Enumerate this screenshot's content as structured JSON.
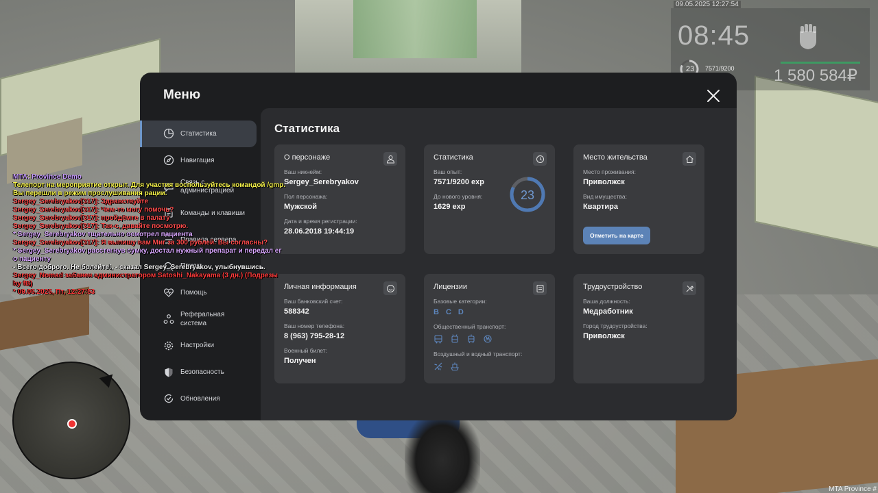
{
  "hud": {
    "date": "09.05.2025 12:27:54",
    "time": "08:45",
    "level": "23",
    "exp": "7571/9200",
    "money": "1 580 584₽"
  },
  "watermark": "MTA Province #",
  "chat": [
    {
      "text": "MTA: Province Demo",
      "color": "#c79bff"
    },
    {
      "text": "Телепорт на мероприятие открыт. Для участия воспользуйтесь командой /gmp.",
      "color": "#f5f24a"
    },
    {
      "text": "Вы перешли в режим прослушивания рации.",
      "color": "#f5f24a"
    },
    {
      "text": "Sergey_Serebryakov[317]: Здравствуйте",
      "color": "#ff4b4b"
    },
    {
      "text": "Sergey_Serebryakov[317]: Чем-то могу помочь?",
      "color": "#ff4b4b"
    },
    {
      "text": "Sergey_Serebryakov[317]: пройдёмте в палату",
      "color": "#ff4b4b"
    },
    {
      "text": "Sergey_Serebryakov[317]: Так-с, давайте посмотрю.",
      "color": "#ff4b4b"
    },
    {
      "text": " * Sergey_Serebryakov тщательно осмотрел пациента",
      "color": "#d9a7ff"
    },
    {
      "text": "Sergey_Serebryakov[317]: Я выпишу вам Миг за 300 рублей. Вы согласны?",
      "color": "#ff4b4b"
    },
    {
      "text": " * Sergey_Serebryakov расстегнув сумку, достал нужный препарат и передал ег",
      "color": "#d9a7ff"
    },
    {
      "text": "о пациенту",
      "color": "#d9a7ff"
    },
    {
      "text": " - Всего доброго. Не болейте!, - сказал Sergey_Serebryakov, улыбнувшись.",
      "color": "#f0f0f0"
    },
    {
      "text": " Sergey_Nomad забанен администратором Satoshi_Nakayama (3 дн.) (Подрезы",
      "color": "#ff3b3b"
    },
    {
      "text": "  by fB)",
      "color": "#ff3b3b"
    },
    {
      "text": " * 09.05.2025, Пт, 12:27:53",
      "color": "#ff3b3b"
    }
  ],
  "menu": {
    "title": "Меню",
    "nav": [
      {
        "label": "Статистика",
        "icon": "chart-pie-icon",
        "active": true
      },
      {
        "label": "Навигация",
        "icon": "compass-icon"
      },
      {
        "label": "Связь с администрацией",
        "icon": "chat-icon"
      },
      {
        "label": "Команды и клавиши",
        "icon": "document-icon"
      },
      {
        "label": "Правила сервера",
        "icon": "rules-icon"
      },
      {
        "label": "Поиск",
        "icon": "search-icon"
      },
      {
        "label": "Помощь",
        "icon": "heart-icon"
      },
      {
        "label": "Реферальная система",
        "icon": "referral-icon"
      },
      {
        "label": "Настройки",
        "icon": "gear-icon"
      },
      {
        "label": "Безопасность",
        "icon": "shield-icon"
      },
      {
        "label": "Обновления",
        "icon": "update-icon"
      }
    ]
  },
  "stats": {
    "title": "Статистика",
    "character": {
      "title": "О персонаже",
      "nick_label": "Ваш никнейм:",
      "nick": "Sergey_Serebryakov",
      "gender_label": "Пол персонажа:",
      "gender": "Мужской",
      "reg_label": "Дата и время регистрации:",
      "reg": "28.06.2018 19:44:19"
    },
    "statistics": {
      "title": "Статистика",
      "exp_label": "Ваш опыт:",
      "exp": "7571/9200 exp",
      "next_label": "До нового уровня:",
      "next": "1629 exp",
      "level": "23",
      "level_progress": 0.823
    },
    "residence": {
      "title": "Место жительства",
      "place_label": "Место проживания:",
      "place": "Приволжск",
      "property_label": "Вид имущества:",
      "property": "Квартира",
      "map_button": "Отметить на карте"
    },
    "personal": {
      "title": "Личная информация",
      "bank_label": "Ваш банковский счет:",
      "bank": "588342",
      "phone_label": "Ваш номер телефона:",
      "phone": "8 (963) 795-28-12",
      "military_label": "Военный билет:",
      "military": "Получен"
    },
    "licenses": {
      "title": "Лицензии",
      "basic_label": "Базовые категории:",
      "categories": [
        "B",
        "C",
        "D"
      ],
      "public_label": "Общественный транспорт:",
      "air_label": "Воздушный и водный транспорт:"
    },
    "employment": {
      "title": "Трудоустройство",
      "position_label": "Ваша должность:",
      "position": "Медработник",
      "city_label": "Город трудоустройства:",
      "city": "Приволжск"
    }
  },
  "colors": {
    "accent": "#5c83b7",
    "panel": "#1d1e20",
    "card": "#3a3b3e",
    "green": "#3e9a62"
  }
}
